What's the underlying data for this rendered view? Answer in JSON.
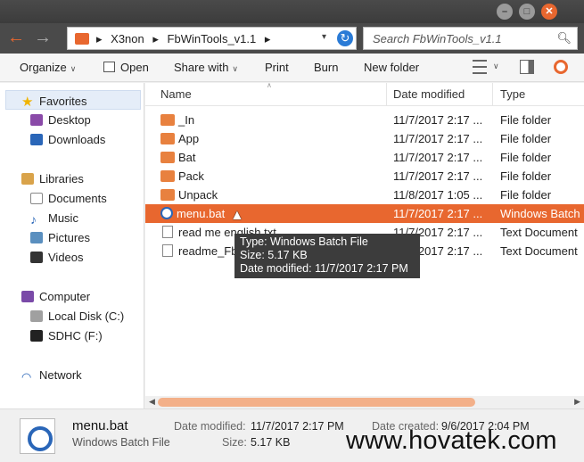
{
  "window": {
    "min": "–",
    "max": "□",
    "close": "✕"
  },
  "address": {
    "crumbs": [
      "X3non",
      "▸",
      "FbWinTools_v1.1",
      "▸"
    ],
    "first_sep": "▸",
    "dropdown": "▾",
    "refresh": "↻"
  },
  "search": {
    "placeholder": "Search FbWinTools_v1.1"
  },
  "toolbar": {
    "organize": "Organize",
    "open": "Open",
    "share_with": "Share with",
    "print": "Print",
    "burn": "Burn",
    "new_folder": "New folder"
  },
  "nav": {
    "favorites": "Favorites",
    "desktop": "Desktop",
    "downloads": "Downloads",
    "libraries": "Libraries",
    "documents": "Documents",
    "music": "Music",
    "pictures": "Pictures",
    "videos": "Videos",
    "computer": "Computer",
    "local_disk": "Local Disk (C:)",
    "sdhc": "SDHC (F:)",
    "network": "Network"
  },
  "columns": {
    "name": "Name",
    "date": "Date modified",
    "type": "Type"
  },
  "files": [
    {
      "name": "_In",
      "date": "11/7/2017 2:17 ...",
      "type": "File folder"
    },
    {
      "name": "App",
      "date": "11/7/2017 2:17 ...",
      "type": "File folder"
    },
    {
      "name": "Bat",
      "date": "11/7/2017 2:17 ...",
      "type": "File folder"
    },
    {
      "name": "Pack",
      "date": "11/7/2017 2:17 ...",
      "type": "File folder"
    },
    {
      "name": "Unpack",
      "date": "11/8/2017 1:05 ...",
      "type": "File folder"
    },
    {
      "name": "menu.bat",
      "date": "11/7/2017 2:17 ...",
      "type": "Windows Batch"
    },
    {
      "name": "read me english.txt",
      "date": "11/7/2017 2:17 ...",
      "type": "Text Document"
    },
    {
      "name": "readme_FbWinTools.txt",
      "date": "11/7/2017 2:17 ...",
      "type": "Text Document"
    }
  ],
  "tooltip": {
    "type": "Type: Windows Batch File",
    "size": "Size: 5.17 KB",
    "modified": "Date modified: 11/7/2017 2:17 PM"
  },
  "details": {
    "name": "menu.bat",
    "kind": "Windows Batch File",
    "modified_label": "Date modified:",
    "modified_value": "11/7/2017 2:17 PM",
    "size_label": "Size:",
    "size_value": "5.17 KB",
    "created_label": "Date created:",
    "created_value": "9/6/2017 2:04 PM"
  },
  "watermark": "www.hovatek.com",
  "colors": {
    "accent": "#e8672f",
    "folder": "#e8813f"
  }
}
